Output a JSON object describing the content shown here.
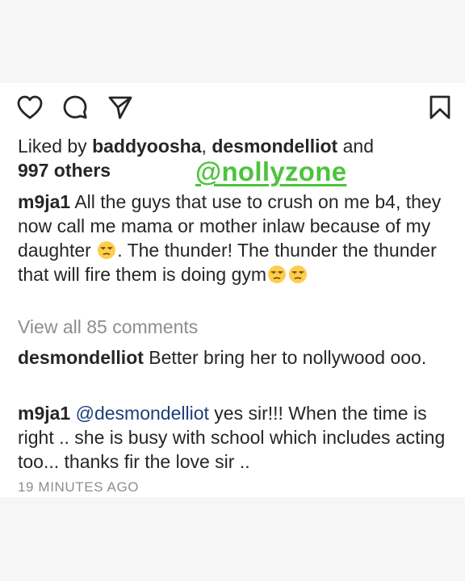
{
  "actions": {
    "like_icon": "heart-outline-icon",
    "comment_icon": "comment-bubble-icon",
    "share_icon": "paper-plane-icon",
    "save_icon": "bookmark-outline-icon"
  },
  "likes": {
    "prefix": "Liked by ",
    "user1": "baddyoosha",
    "sep": ", ",
    "user2": "desmondelliot",
    "and": " and",
    "others": "997 others"
  },
  "watermark": "@nollyzone",
  "caption": {
    "username": "m9ja1",
    "text_a": " All the guys that use to crush on me b4, they now call me mama or mother inlaw because of my daughter ",
    "text_b": ". The thunder! The thunder the thunder that will fire them is doing gym",
    "emoji": "unamused-face"
  },
  "view_all": "View all 85 comments",
  "comments": [
    {
      "username": "desmondelliot",
      "text": " Better bring her to nollywood ooo."
    },
    {
      "username": "m9ja1",
      "mention": "@desmondelliot",
      "text": " yes sir!!! When the time is right .. she is busy with school which includes acting too... thanks fir the love sir .."
    }
  ],
  "timestamp": "19 MINUTES AGO",
  "colors": {
    "text": "#262626",
    "muted": "#8e8e8e",
    "mention": "#1c3f7a",
    "watermark": "#4cc43c",
    "background": "#f6f6f6",
    "card": "#ffffff"
  }
}
